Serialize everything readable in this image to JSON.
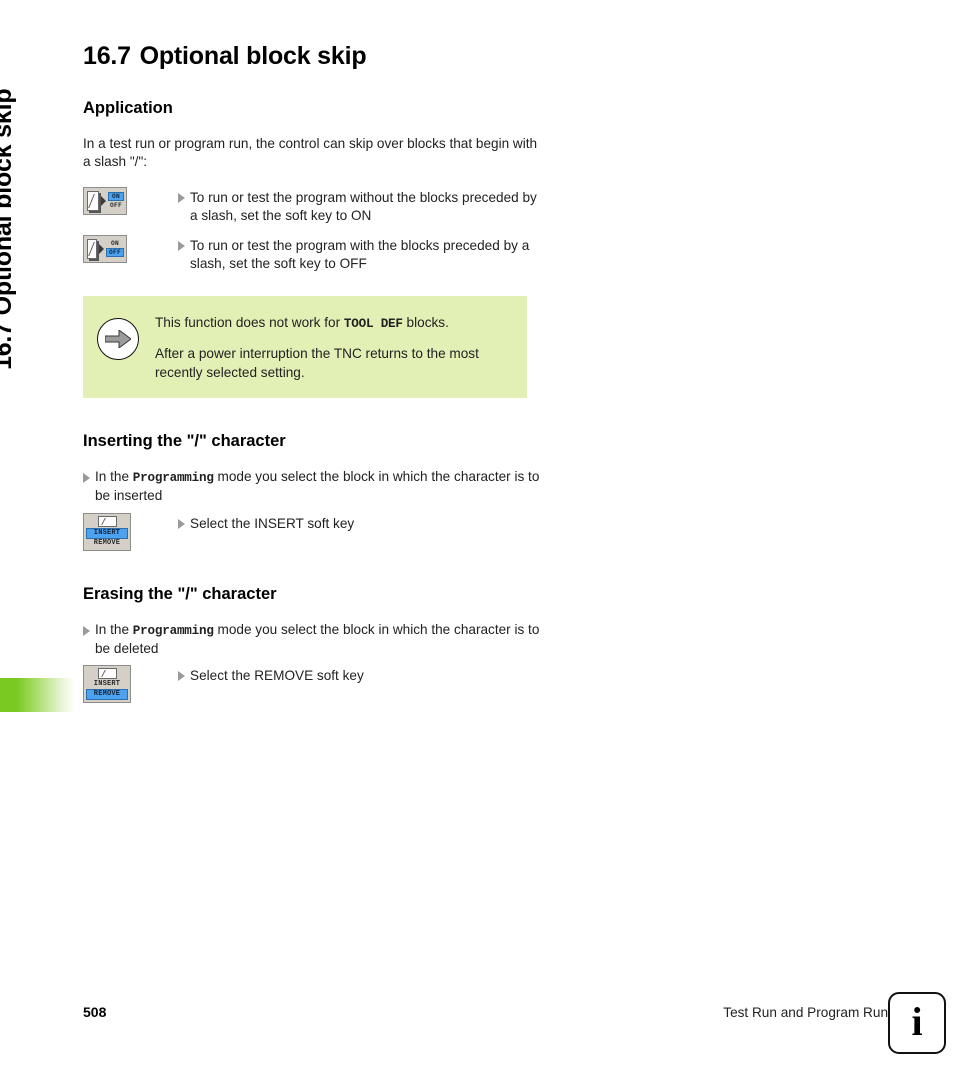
{
  "sidebar": {
    "vertical_title": "16.7 Optional block skip"
  },
  "page": {
    "section_number": "16.7",
    "section_title": "Optional block skip",
    "heading_full": "16.7 Optional block skip"
  },
  "application": {
    "heading": "Application",
    "intro": "In a test run or program run, the control can skip over blocks that begin with a slash \"/\":",
    "items": [
      {
        "text": "To run or test the program without the blocks preceded by a slash, set the soft key to ON",
        "softkey": {
          "state_on": "ON",
          "state_off": "OFF",
          "active": "ON"
        }
      },
      {
        "text": "To run or test the program with the blocks preceded by a slash, set the soft key to OFF",
        "softkey": {
          "state_on": "ON",
          "state_off": "OFF",
          "active": "OFF"
        }
      }
    ]
  },
  "note": {
    "icon": "arrow-right-circle-icon",
    "background_color": "#e2f0b6",
    "line1_before": "This function does not work for ",
    "line1_code": "TOOL DEF",
    "line1_after": " blocks.",
    "line2": "After a power interruption the TNC returns to the most recently selected setting."
  },
  "inserting": {
    "heading": "Inserting the \"/\" character",
    "step1_before": "In the ",
    "step1_code": "Programming",
    "step1_after": " mode you select the block in which the character is to be inserted",
    "step2": "Select the INSERT soft key",
    "softkey": {
      "top_label": "INSERT",
      "bottom_label": "REMOVE",
      "active": "INSERT"
    }
  },
  "erasing": {
    "heading": "Erasing the \"/\" character",
    "step1_before": "In the ",
    "step1_code": "Programming",
    "step1_after": " mode you select the block in which the character is to be deleted",
    "step2": "Select the REMOVE soft key",
    "softkey": {
      "top_label": "INSERT",
      "bottom_label": "REMOVE",
      "active": "REMOVE"
    }
  },
  "footer": {
    "page_number": "508",
    "chapter_title": "Test Run and Program Run",
    "info_glyph": "i"
  },
  "colors": {
    "accent_green": "#7ac922",
    "note_green": "#e2f0b6",
    "softkey_highlight": "#4da2f0",
    "softkey_face": "#d4d0c8"
  }
}
